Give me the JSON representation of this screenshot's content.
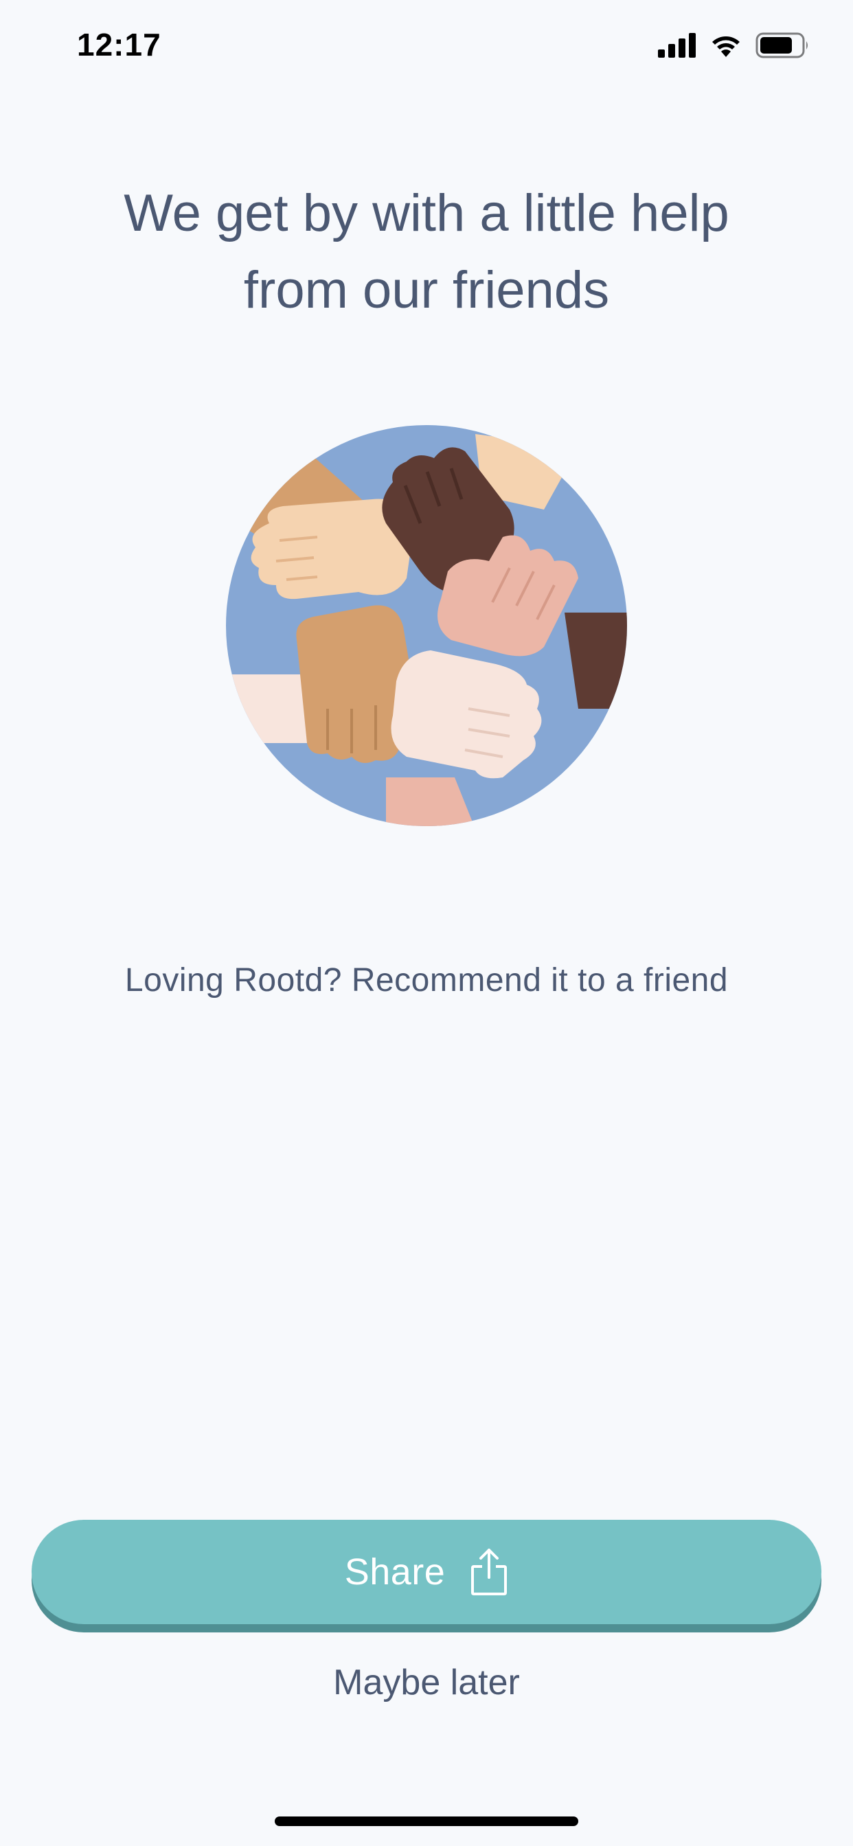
{
  "status_bar": {
    "time": "12:17"
  },
  "headline": {
    "line1": "We get by with a little help",
    "line2": "from our friends"
  },
  "illustration": {
    "icon": "hands-circle-illustration",
    "colors": {
      "circle": "#86A7D4",
      "skin_light": "#F5D3B0",
      "skin_dark": "#5E3B33",
      "skin_tan": "#D49F6E",
      "skin_pink": "#EBB6A7",
      "skin_pale": "#F8E5DD"
    }
  },
  "subtext": "Loving Rootd? Recommend it to a friend",
  "share_button": {
    "label": "Share",
    "icon": "share-icon",
    "color": "#76C2C5"
  },
  "secondary_action": {
    "label": "Maybe later"
  },
  "colors": {
    "background": "#F7F9FC",
    "text": "#4B5872"
  }
}
